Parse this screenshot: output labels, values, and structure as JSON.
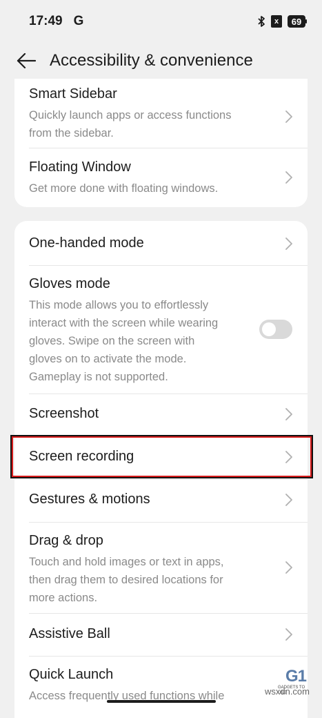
{
  "status_bar": {
    "time": "17:49",
    "carrier_icon_text": "G",
    "sim_icon": "sim-x-icon",
    "sim_text": "x",
    "battery_level": "69",
    "icons": [
      "bluetooth-icon",
      "sim-x-icon",
      "battery-icon"
    ]
  },
  "app_bar": {
    "title": "Accessibility & convenience",
    "back_icon": "back-arrow-icon"
  },
  "section_1": {
    "items": [
      {
        "title": "Smart Sidebar",
        "desc_lines": [
          "Quickly launch apps or access functions",
          "from the sidebar."
        ]
      },
      {
        "title": "Floating Window",
        "desc_lines": [
          "Get more done with floating windows."
        ]
      }
    ]
  },
  "section_2": {
    "items": [
      {
        "title": "One-handed mode"
      },
      {
        "title": "Gloves mode",
        "desc_lines": [
          "This mode allows you to effortlessly",
          "interact with the screen while wearing",
          "gloves. Swipe on the screen with",
          "gloves on to activate the mode.",
          "Gameplay is not supported."
        ],
        "toggle": "off"
      },
      {
        "title": "Screenshot"
      },
      {
        "title": "Screen recording",
        "highlighted": true
      },
      {
        "title": "Gestures & motions"
      },
      {
        "title": "Drag & drop",
        "desc_lines": [
          "Touch and hold images or text in apps,",
          "then drag them to desired locations for",
          "more actions."
        ]
      },
      {
        "title": "Assistive Ball"
      },
      {
        "title": "Quick Launch",
        "desc_lines": [
          "Access frequently used functions while"
        ]
      }
    ]
  },
  "watermark": {
    "logo": "G1",
    "sub": "GADGETS TO USE",
    "site": "wsxdn.com"
  },
  "colors": {
    "highlight": "#d71a1a",
    "background": "#f0f0f0",
    "card": "#ffffff"
  }
}
